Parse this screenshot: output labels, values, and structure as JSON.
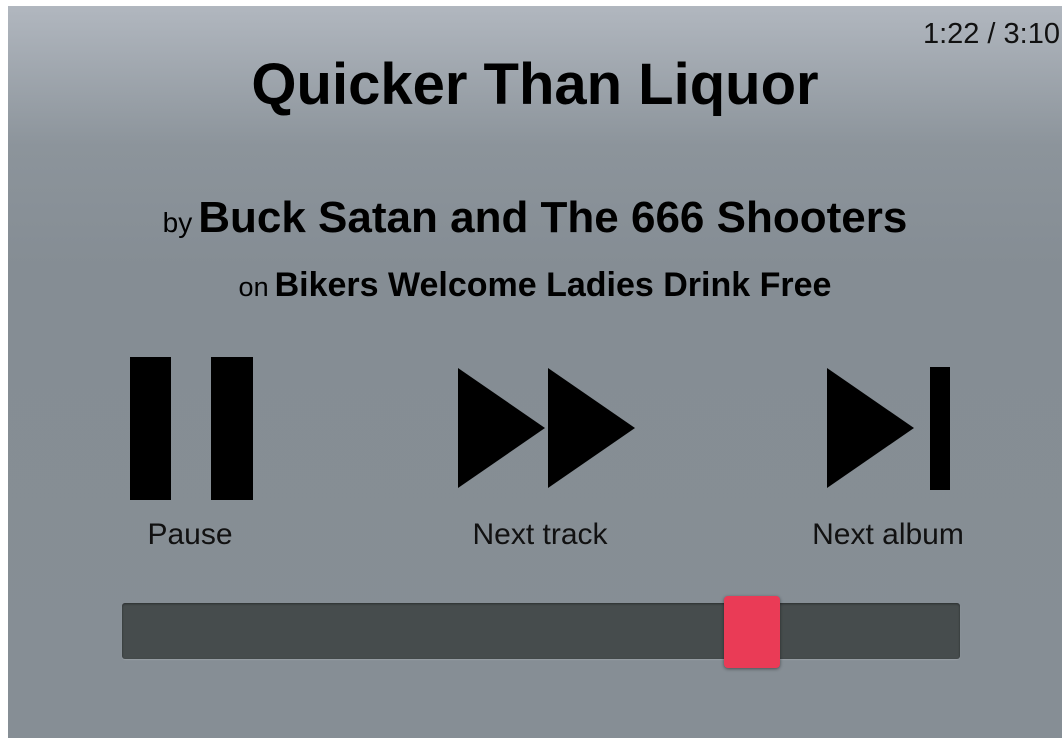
{
  "player": {
    "time_display": "1:22 / 3:10",
    "track_title": "Quicker Than Liquor",
    "artist_prefix": "by",
    "artist_name": "Buck Satan and The 666 Shooters",
    "album_prefix": "on",
    "album_name": "Bikers Welcome Ladies Drink Free",
    "controls": [
      {
        "label": "Pause",
        "icon": "pause-icon"
      },
      {
        "label": "Next track",
        "icon": "fast-forward-icon"
      },
      {
        "label": "Next album",
        "icon": "skip-next-icon"
      }
    ],
    "progress": {
      "elapsed_seconds": 82,
      "total_seconds": 190,
      "fraction": 0.752
    }
  },
  "colors": {
    "background_top": "#b1b7bf",
    "background_bottom": "#868e95",
    "track": "#464c4d",
    "handle": "#ea3b56",
    "icon": "#000000"
  }
}
